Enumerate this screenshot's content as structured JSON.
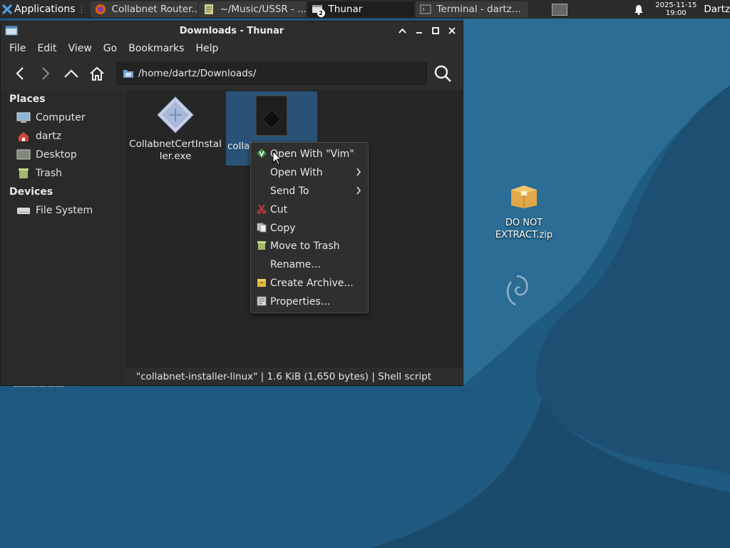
{
  "panel": {
    "applications_label": "Applications",
    "tasks": [
      {
        "label": "Collabnet Router...",
        "icon": "firefox-icon"
      },
      {
        "label": "~/Music/USSR - ...",
        "icon": "text-editor-icon"
      },
      {
        "label": "Thunar",
        "icon": "file-manager-icon",
        "badge": "2"
      },
      {
        "label": "Terminal - dartz...",
        "icon": "terminal-icon"
      }
    ],
    "clock_date": "2025-11-15",
    "clock_time": "19:00",
    "user": "Dartz"
  },
  "desktop": {
    "zip_label": "DO NOT EXTRACT.zip",
    "hidden_label": "—————— ···"
  },
  "window": {
    "title": "Downloads - Thunar",
    "menu": [
      "File",
      "Edit",
      "View",
      "Go",
      "Bookmarks",
      "Help"
    ],
    "location_value": "/home/dartz/Downloads/",
    "places_heading": "Places",
    "places": [
      "Computer",
      "dartz",
      "Desktop",
      "Trash"
    ],
    "devices_heading": "Devices",
    "devices": [
      "File System"
    ],
    "files": [
      {
        "name": "CollabnetCertInstaller.exe",
        "type": "executable"
      },
      {
        "name": "collabnet-installer-linux",
        "visible_text": "collal",
        "type": "shell-script",
        "selected": true
      }
    ],
    "status": "\"collabnet-installer-linux\"  |  1.6 KiB (1,650 bytes)  |  Shell script"
  },
  "context_menu": {
    "items": [
      {
        "label": "Open With \"Vim\"",
        "icon": "vim-icon"
      },
      {
        "label": "Open With",
        "submenu": true
      },
      {
        "label": "Send To",
        "submenu": true
      },
      {
        "label": "Cut",
        "icon": "scissors-icon"
      },
      {
        "label": "Copy",
        "icon": "copy-icon"
      },
      {
        "label": "Move to Trash",
        "icon": "trash-icon"
      },
      {
        "label": "Rename..."
      },
      {
        "label": "Create Archive...",
        "icon": "archive-icon"
      },
      {
        "label": "Properties...",
        "icon": "properties-icon"
      }
    ]
  },
  "colors": {
    "panel_bg": "#2b2b2b",
    "window_bg": "#2d2d2d",
    "selection": "#2a5277",
    "desktop_blue": "#1f5a80"
  }
}
